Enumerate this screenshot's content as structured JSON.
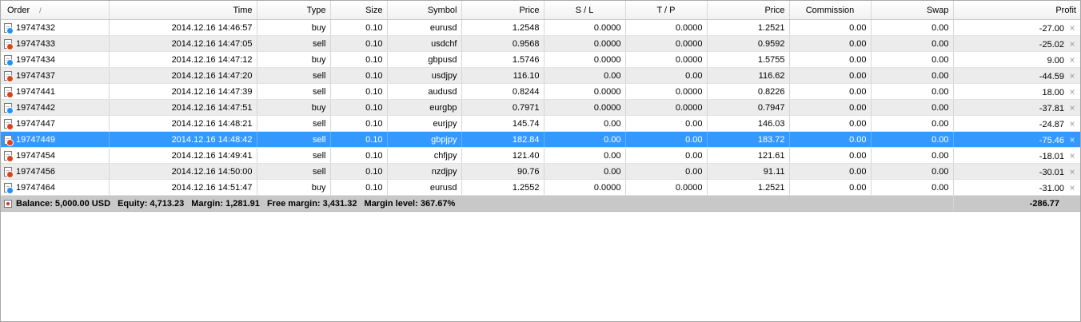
{
  "columns": [
    "Order",
    "Time",
    "Type",
    "Size",
    "Symbol",
    "Price",
    "S / L",
    "T / P",
    "Price",
    "Commission",
    "Swap",
    "Profit"
  ],
  "sort_glyph": "/",
  "colors": {
    "buy_marker": "#1e90ff",
    "sell_marker": "#e0401c",
    "selected_row": "#3399ff",
    "summary_bg": "#c8c8c8"
  },
  "close_glyph": "×",
  "orders": [
    {
      "order": "19747432",
      "time": "2014.12.16 14:46:57",
      "type": "buy",
      "size": "0.10",
      "symbol": "eurusd",
      "price": "1.2548",
      "sl": "0.0000",
      "tp": "0.0000",
      "current_price": "1.2521",
      "commission": "0.00",
      "swap": "0.00",
      "profit": "-27.00"
    },
    {
      "order": "19747433",
      "time": "2014.12.16 14:47:05",
      "type": "sell",
      "size": "0.10",
      "symbol": "usdchf",
      "price": "0.9568",
      "sl": "0.0000",
      "tp": "0.0000",
      "current_price": "0.9592",
      "commission": "0.00",
      "swap": "0.00",
      "profit": "-25.02"
    },
    {
      "order": "19747434",
      "time": "2014.12.16 14:47:12",
      "type": "buy",
      "size": "0.10",
      "symbol": "gbpusd",
      "price": "1.5746",
      "sl": "0.0000",
      "tp": "0.0000",
      "current_price": "1.5755",
      "commission": "0.00",
      "swap": "0.00",
      "profit": "9.00"
    },
    {
      "order": "19747437",
      "time": "2014.12.16 14:47:20",
      "type": "sell",
      "size": "0.10",
      "symbol": "usdjpy",
      "price": "116.10",
      "sl": "0.00",
      "tp": "0.00",
      "current_price": "116.62",
      "commission": "0.00",
      "swap": "0.00",
      "profit": "-44.59"
    },
    {
      "order": "19747441",
      "time": "2014.12.16 14:47:39",
      "type": "sell",
      "size": "0.10",
      "symbol": "audusd",
      "price": "0.8244",
      "sl": "0.0000",
      "tp": "0.0000",
      "current_price": "0.8226",
      "commission": "0.00",
      "swap": "0.00",
      "profit": "18.00"
    },
    {
      "order": "19747442",
      "time": "2014.12.16 14:47:51",
      "type": "buy",
      "size": "0.10",
      "symbol": "eurgbp",
      "price": "0.7971",
      "sl": "0.0000",
      "tp": "0.0000",
      "current_price": "0.7947",
      "commission": "0.00",
      "swap": "0.00",
      "profit": "-37.81"
    },
    {
      "order": "19747447",
      "time": "2014.12.16 14:48:21",
      "type": "sell",
      "size": "0.10",
      "symbol": "eurjpy",
      "price": "145.74",
      "sl": "0.00",
      "tp": "0.00",
      "current_price": "146.03",
      "commission": "0.00",
      "swap": "0.00",
      "profit": "-24.87"
    },
    {
      "order": "19747449",
      "time": "2014.12.16 14:48:42",
      "type": "sell",
      "size": "0.10",
      "symbol": "gbpjpy",
      "price": "182.84",
      "sl": "0.00",
      "tp": "0.00",
      "current_price": "183.72",
      "commission": "0.00",
      "swap": "0.00",
      "profit": "-75.46",
      "selected": true
    },
    {
      "order": "19747454",
      "time": "2014.12.16 14:49:41",
      "type": "sell",
      "size": "0.10",
      "symbol": "chfjpy",
      "price": "121.40",
      "sl": "0.00",
      "tp": "0.00",
      "current_price": "121.61",
      "commission": "0.00",
      "swap": "0.00",
      "profit": "-18.01"
    },
    {
      "order": "19747456",
      "time": "2014.12.16 14:50:00",
      "type": "sell",
      "size": "0.10",
      "symbol": "nzdjpy",
      "price": "90.76",
      "sl": "0.00",
      "tp": "0.00",
      "current_price": "91.11",
      "commission": "0.00",
      "swap": "0.00",
      "profit": "-30.01"
    },
    {
      "order": "19747464",
      "time": "2014.12.16 14:51:47",
      "type": "buy",
      "size": "0.10",
      "symbol": "eurusd",
      "price": "1.2552",
      "sl": "0.0000",
      "tp": "0.0000",
      "current_price": "1.2521",
      "commission": "0.00",
      "swap": "0.00",
      "profit": "-31.00"
    }
  ],
  "summary": {
    "balance": "Balance: 5,000.00 USD",
    "equity": "Equity: 4,713.23",
    "margin": "Margin: 1,281.91",
    "free_margin": "Free margin: 3,431.32",
    "margin_level": "Margin level: 367.67%",
    "total_profit": "-286.77"
  }
}
